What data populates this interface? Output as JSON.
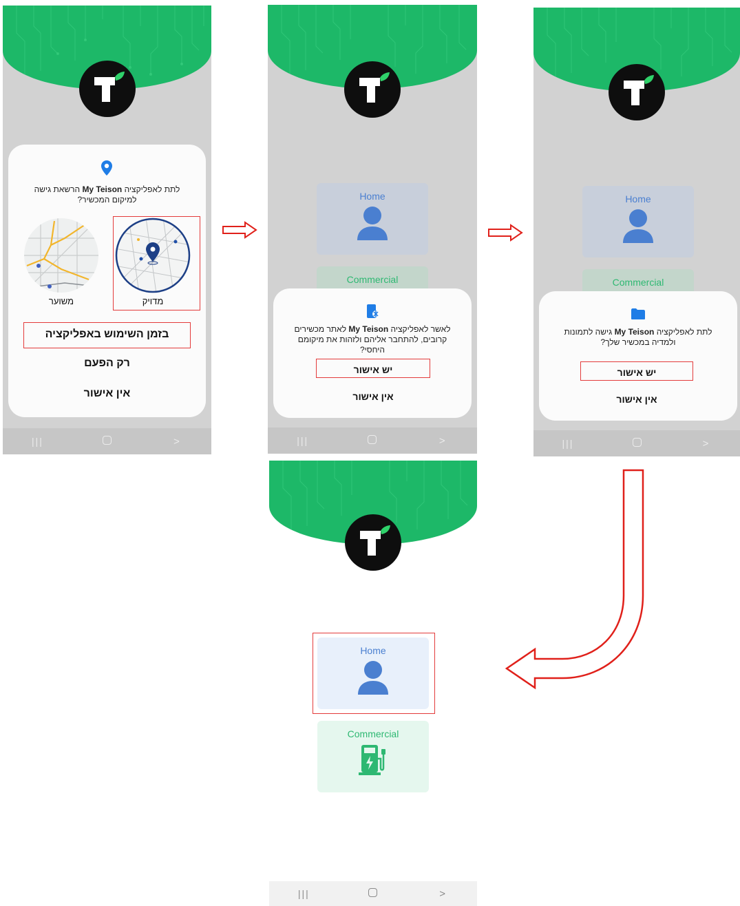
{
  "brand": {
    "green": "#1db868",
    "logo_leaf": "#2fd16a",
    "highlight": "#e33a3a",
    "tile_blue": "#4a7fd0",
    "tile_green": "#2eb872"
  },
  "location_dialog": {
    "icon": "location-pin-icon",
    "text_pre": "לתת לאפליקציה ",
    "app_name": "My Teison",
    "text_post": " הרשאת גישה למיקום המכשיר?",
    "option_approximate": "משוער",
    "option_precise": "מדויק",
    "while_using": "בזמן השימוש באפליקציה",
    "only_this_time": "רק הפעם",
    "deny": "אין אישור"
  },
  "nearby_dialog": {
    "icon": "nearby-devices-icon",
    "text_pre": "לאשר לאפליקציה ",
    "app_name": "My Teison",
    "text_post": " לאתר מכשירים קרובים, להתחבר אליהם ולזהות את מיקומם היחסי?",
    "allow": "יש אישור",
    "deny": "אין אישור"
  },
  "media_dialog": {
    "icon": "folder-icon",
    "text_pre": "לתת לאפליקציה ",
    "app_name": "My Teison",
    "text_post": " גישה לתמונות ולמדיה במכשיר שלך?",
    "allow": "יש אישור",
    "deny": "אין אישור"
  },
  "tiles": {
    "home": "Home",
    "commercial": "Commercial"
  },
  "navbar": {
    "recent": "|||",
    "back": ">"
  }
}
